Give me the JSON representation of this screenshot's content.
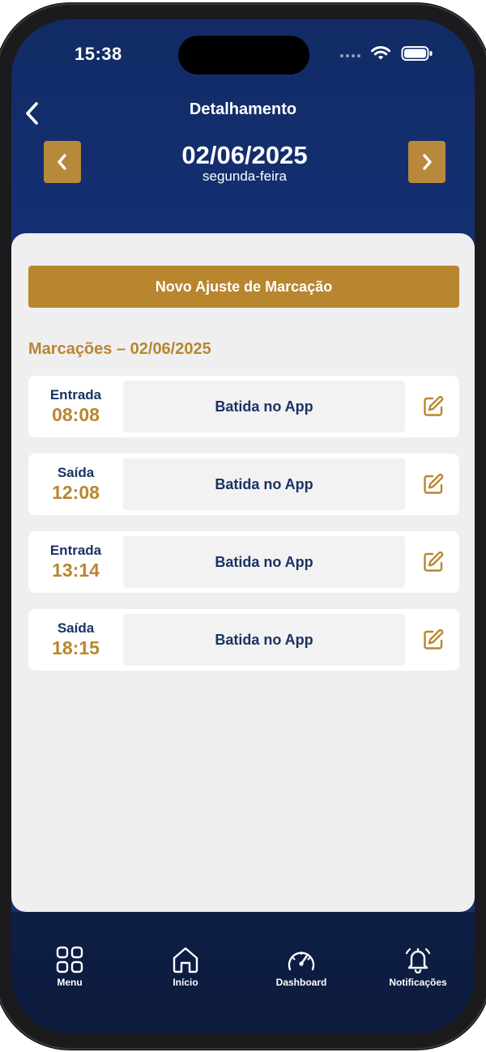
{
  "status_bar": {
    "time": "15:38"
  },
  "header": {
    "title": "Detalhamento",
    "date": "02/06/2025",
    "weekday": "segunda-feira"
  },
  "content": {
    "adjust_button_label": "Novo Ajuste de Marcação",
    "section_title": "Marcações – 02/06/2025",
    "marks": [
      {
        "type": "Entrada",
        "time": "08:08",
        "source": "Batida no App"
      },
      {
        "type": "Saída",
        "time": "12:08",
        "source": "Batida no App"
      },
      {
        "type": "Entrada",
        "time": "13:14",
        "source": "Batida no App"
      },
      {
        "type": "Saída",
        "time": "18:15",
        "source": "Batida no App"
      }
    ]
  },
  "bottom_nav": {
    "items": [
      {
        "label": "Menu",
        "icon": "grid-icon"
      },
      {
        "label": "Início",
        "icon": "home-icon"
      },
      {
        "label": "Dashboard",
        "icon": "speedometer-icon"
      },
      {
        "label": "Notificações",
        "icon": "bell-icon"
      }
    ]
  },
  "colors": {
    "header_blue": "#13306e",
    "accent_gold": "#b8862f",
    "text_navy": "#1b3264",
    "card_bg": "#efefef"
  }
}
